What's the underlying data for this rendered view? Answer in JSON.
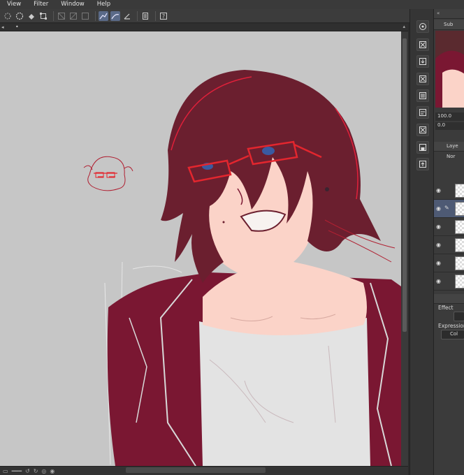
{
  "menubar": {
    "items": [
      "View",
      "Filter",
      "Window",
      "Help"
    ]
  },
  "toolbar": {
    "icons": [
      "lasso-icon",
      "select-all-icon",
      "fill-icon",
      "transform-icon",
      "clear-selection-icon",
      "invert-selection-icon",
      "mask-icon",
      "ruler-snap-icon",
      "ruler-curve-icon",
      "ruler-perspective-icon",
      "document-icon",
      "help-icon"
    ]
  },
  "canvas": {
    "background": "#c6c6c6"
  },
  "command_bar": {
    "icons": [
      "navigator-icon",
      "close-icon",
      "import-icon",
      "close-alt-icon",
      "export-icon",
      "batch-icon",
      "select-icon",
      "save-icon",
      "export-alt-icon"
    ]
  },
  "right_panel": {
    "subview_label": "Sub",
    "zoom_value": "100.0",
    "rotation_value": "0.0",
    "layer_tab_label": "Laye",
    "blend_mode_label": "Nor",
    "properties": {
      "effect_label": "Effect",
      "expression_label": "Expression c",
      "color_button_label": "Col"
    }
  },
  "colors": {
    "accent": "#5a6a88",
    "character_hair": "#6b1f2f",
    "character_outline": "#e0203a",
    "glasses": "#e3262e",
    "jacket": "#7a1732",
    "skin": "#fbd3c8",
    "shirt": "#e3e3e3"
  }
}
